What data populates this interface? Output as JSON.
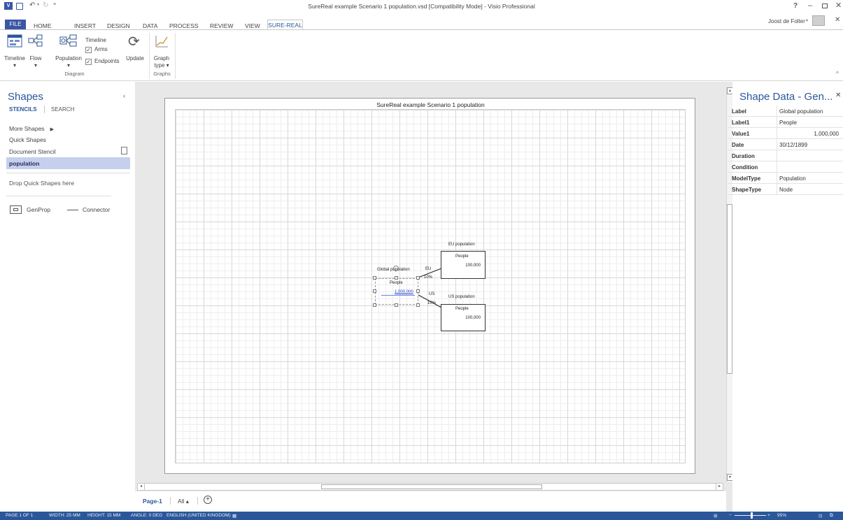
{
  "window": {
    "title": "SureReal example Scenario 1 population.vsd  [Compatibility Mode] - Visio Professional",
    "user": "Joost de Folter",
    "help": "?"
  },
  "ribbon_tabs": [
    "FILE",
    "HOME",
    "INSERT",
    "DESIGN",
    "DATA",
    "PROCESS",
    "REVIEW",
    "VIEW",
    "SURE-REAL"
  ],
  "ribbon": {
    "timeline_label": "Timeline",
    "flow_label": "Flow",
    "population_label": "Population",
    "timeline_check_label": "Timeline",
    "arms_label": "Arms",
    "endpoints_label": "Endpoints",
    "update_label": "Update",
    "graph_label": "Graph",
    "graph_type_label": "type",
    "group_diagram": "Diagram",
    "group_graphs": "Graphs",
    "arms_checked": true,
    "endpoints_checked": true
  },
  "shapes_pane": {
    "title": "Shapes",
    "tab_stencils": "STENCILS",
    "tab_search": "SEARCH",
    "more_shapes": "More Shapes",
    "quick_shapes": "Quick Shapes",
    "document_stencil": "Document Stencil",
    "population": "population",
    "drop_text": "Drop Quick Shapes here",
    "genprop": "GenProp",
    "connector": "Connector"
  },
  "diagram": {
    "page_title": "SureReal example Scenario 1 population",
    "global_label": "Global population",
    "global_people": "People",
    "global_value": "1,000,000",
    "eu_title": "EU population",
    "eu_people": "People",
    "eu_value": "100,000",
    "eu_conn_label": "EU",
    "eu_pct": "10%",
    "us_title": "US population",
    "us_people": "People",
    "us_value": "100,000",
    "us_conn_label": "US",
    "us_pct": "10%"
  },
  "page_tabs": {
    "page1": "Page-1",
    "all": "All ▴"
  },
  "shape_data": {
    "title": "Shape Data - Gen...",
    "rows": [
      {
        "key": "Label",
        "value": "Global population"
      },
      {
        "key": "Label1",
        "value": "People"
      },
      {
        "key": "Value1",
        "value": "1,000,000"
      },
      {
        "key": "Date",
        "value": "30/12/1899"
      },
      {
        "key": "Duration",
        "value": ""
      },
      {
        "key": "Condition",
        "value": ""
      },
      {
        "key": "ModelType",
        "value": "Population"
      },
      {
        "key": "ShapeType",
        "value": "Node"
      }
    ]
  },
  "status": {
    "page": "PAGE 1 OF 1",
    "width": "WIDTH: 25 MM",
    "height": "HEIGHT: 15 MM",
    "angle": "ANGLE: 0 DEG",
    "language": "ENGLISH (UNITED KINGDOM)",
    "zoom": "95%"
  },
  "colors": {
    "accent": "#2b579a",
    "file_tab": "#3a56a5",
    "selected_stencil": "#c5d0ee"
  }
}
